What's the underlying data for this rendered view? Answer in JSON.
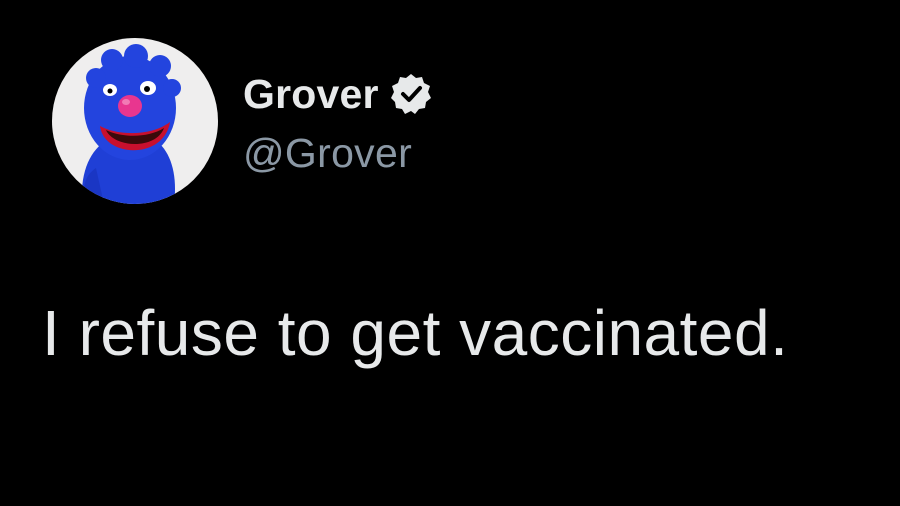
{
  "tweet": {
    "author": {
      "display_name": "Grover",
      "handle": "@Grover",
      "verified": true,
      "avatar_icon": "grover-avatar"
    },
    "text": "I refuse to get vaccinated."
  },
  "colors": {
    "background": "#000000",
    "primary_text": "#e7e9ea",
    "secondary_text": "#8b98a5",
    "avatar_bg": "#efeeee",
    "grover_blue": "#1f3fd6"
  }
}
